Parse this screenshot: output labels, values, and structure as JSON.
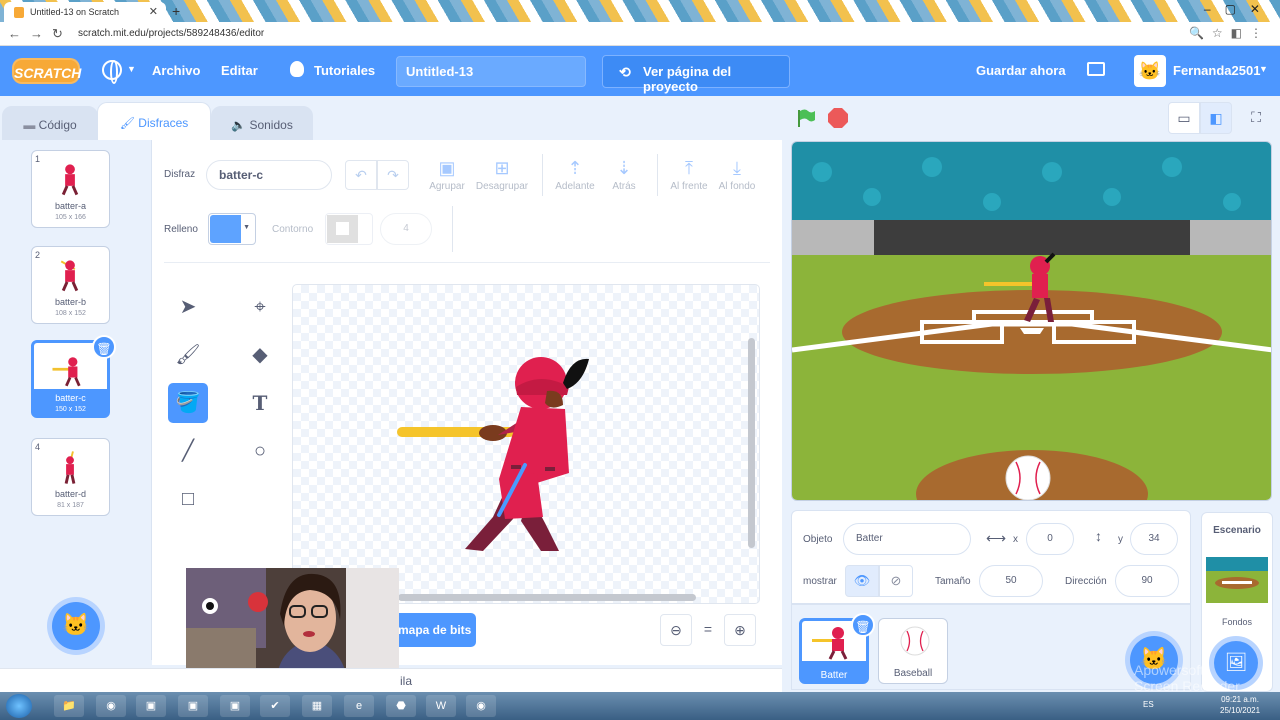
{
  "browser": {
    "tab_title": "Untitled-13 on Scratch",
    "url": "scratch.mit.edu/projects/589248436/editor"
  },
  "menubar": {
    "logo": "SCRATCH",
    "archivo": "Archivo",
    "editar": "Editar",
    "tutoriales": "Tutoriales",
    "project_title": "Untitled-13",
    "view_project": "Ver página del proyecto",
    "save_now": "Guardar ahora",
    "username": "Fernanda2501"
  },
  "tabs": {
    "code": "Código",
    "costumes": "Disfraces",
    "sounds": "Sonidos"
  },
  "costumes": [
    {
      "num": "1",
      "name": "batter-a",
      "size": "105 x 166"
    },
    {
      "num": "2",
      "name": "batter-b",
      "size": "108 x 152"
    },
    {
      "num": "3",
      "name": "batter-c",
      "size": "150 x 152"
    },
    {
      "num": "4",
      "name": "batter-d",
      "size": "81 x 187"
    }
  ],
  "paint": {
    "costume_label": "Disfraz",
    "costume_name": "batter-c",
    "group": "Agrupar",
    "ungroup": "Desagrupar",
    "forward": "Adelante",
    "backward": "Atrás",
    "front": "Al frente",
    "back": "Al fondo",
    "fill_label": "Relleno",
    "fill_color": "#5ea3ff",
    "outline_label": "Contorno",
    "stroke_width": "4",
    "convert_button": "mapa de bits",
    "zoom_equal": "="
  },
  "backpack": {
    "label": "ila"
  },
  "sprite": {
    "object_label": "Objeto",
    "name": "Batter",
    "x_label": "x",
    "x": "0",
    "y_label": "y",
    "y": "34",
    "show_label": "mostrar",
    "size_label": "Tamaño",
    "size": "50",
    "direction_label": "Dirección",
    "direction": "90"
  },
  "sprites": [
    {
      "name": "Batter"
    },
    {
      "name": "Baseball"
    }
  ],
  "stage_panel": {
    "title": "Escenario",
    "backdrops": "Fondos"
  },
  "taskbar": {
    "lang": "ES",
    "time": "09:21 a.m.",
    "date": "25/10/2021"
  },
  "watermark": {
    "line1": "Apowersoft",
    "line2": "Screen Recorder"
  },
  "colors": {
    "scratch_blue": "#4d97ff",
    "stop_red": "#ec5959",
    "flag_green": "#4cbf56"
  }
}
